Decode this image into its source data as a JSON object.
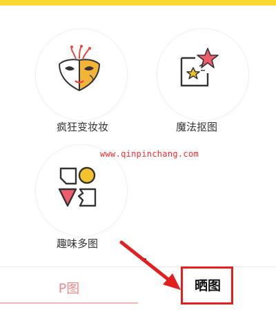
{
  "features": [
    {
      "label": "疯狂变妆妆",
      "icon": "mask-icon"
    },
    {
      "label": "魔法抠图",
      "icon": "magic-star-icon"
    },
    {
      "label": "趣味多图",
      "icon": "shapes-collage-icon"
    }
  ],
  "watermark": "www.qinpinchang.com",
  "tabs": [
    {
      "label": "P图",
      "active": true
    },
    {
      "label": "晒图",
      "active": false
    }
  ],
  "colors": {
    "accent_yellow": "#f7d92f",
    "accent_red": "#e41f1f",
    "tab_active_pink": "#f08a8a"
  }
}
